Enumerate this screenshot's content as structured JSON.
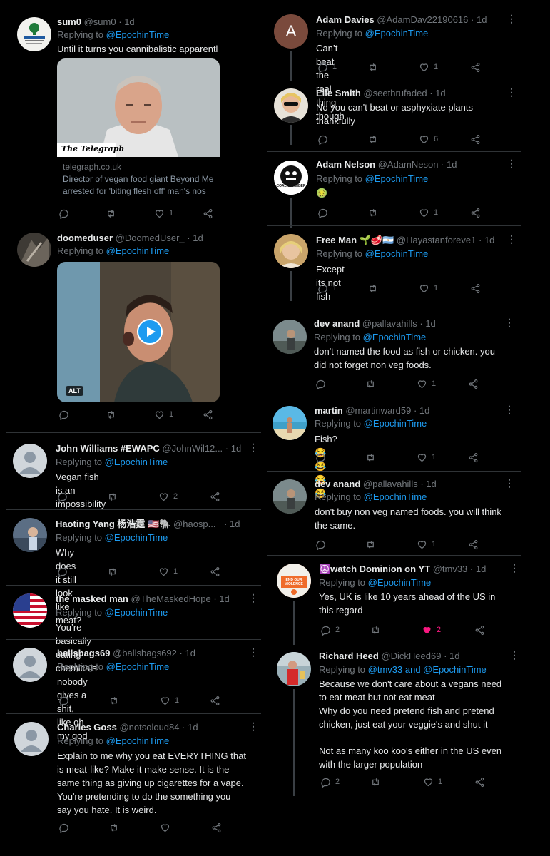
{
  "colors": {
    "bg": "#000000",
    "link": "#1d9bf0",
    "muted": "#71767b",
    "text": "#e7e9ea",
    "like_active": "#f91880"
  },
  "left": [
    {
      "name": "sum0",
      "handle": "@sum0",
      "time": "1d",
      "reply_label": "Replying to",
      "reply_to": "@EpochinTime",
      "text": "Until it turns you cannibalistic apparentl",
      "card": {
        "brand": "The Telegraph",
        "domain": "telegraph.co.uk",
        "desc1": "Director of vegan food giant Beyond Me",
        "desc2": "arrested for 'biting flesh off' man's nos"
      },
      "likes": "1"
    },
    {
      "name": "doomeduser",
      "handle": "@DoomedUser_",
      "time": "1d",
      "reply_label": "Replying to",
      "reply_to": "@EpochinTime",
      "media_alt": "ALT",
      "likes": "1"
    },
    {
      "name": "John Williams #EWAPC",
      "handle": "@JohnWil12...",
      "time": "1d",
      "reply_label": "Replying to",
      "reply_to": "@EpochinTime",
      "text": "Vegan fish is an impossibility",
      "likes": "2"
    },
    {
      "name": "Haoting Yang 杨浩霆 🇺🇸🐘",
      "handle": "@haosp...",
      "time": "1d",
      "reply_label": "Replying to",
      "reply_to": "@EpochinTime",
      "text": "Why does it still look like meat?",
      "likes": "1"
    },
    {
      "name": "the masked man",
      "handle": "@TheMaskedHope",
      "time": "1d",
      "reply_label": "Replying to",
      "reply_to": "@EpochinTime",
      "text": "You’re basically eating chemicals"
    },
    {
      "name": "ballsbags69",
      "handle": "@ballsbags692",
      "time": "1d",
      "reply_label": "Replying to",
      "reply_to": "@EpochinTime",
      "text": "nobody gives a shit, like oh my god",
      "likes": "1"
    },
    {
      "name": "Charles Goss",
      "handle": "@notsoloud84",
      "time": "1d",
      "reply_label": "Replying to",
      "reply_to": "@EpochinTime",
      "lines": [
        "Explain to me why you eat EVERYTHING that",
        "is meat-like? Make it make sense. It is the",
        "same thing as giving up cigarettes for a vape.",
        "You're pretending to do the something you",
        "say you hate. It is weird."
      ]
    }
  ],
  "right": [
    {
      "name": "Adam Davies",
      "handle": "@AdamDav22190616",
      "time": "1d",
      "avatar_letter": "A",
      "reply_label": "Replying to",
      "reply_to": "@EpochinTime",
      "text": "Can’t beat the real thing though",
      "replies": "1",
      "likes": "1"
    },
    {
      "name": "Elle Smith",
      "handle": "@seethrufaded",
      "time": "1d",
      "lines": [
        "No you can't beat or asphyxiate plants",
        "thankfully"
      ],
      "likes": "6"
    },
    {
      "name": "Adam Nelson",
      "handle": "@AdamNeson",
      "time": "1d",
      "avatar_text": "COAL CHAMBER",
      "reply_label": "Replying to",
      "reply_to": "@EpochinTime",
      "text": "🤢",
      "likes": "1"
    },
    {
      "name": "Free Man 🌱🥩🇦🇷",
      "handle": "@Hayastanforeve1",
      "time": "1d",
      "reply_label": "Replying to",
      "reply_to": "@EpochinTime",
      "text": "Except its not fish",
      "replies": "1",
      "likes": "1"
    },
    {
      "name": "dev anand",
      "handle": "@pallavahills",
      "time": "1d",
      "reply_label": "Replying to",
      "reply_to": "@EpochinTime",
      "lines": [
        "don't named the food as fish or chicken. you",
        "did not forget non veg foods."
      ],
      "likes": "1"
    },
    {
      "name": "martin",
      "handle": "@martinward59",
      "time": "1d",
      "reply_label": "Replying to",
      "reply_to": "@EpochinTime",
      "text": "Fish? 😂😂😂😂",
      "likes": "1"
    },
    {
      "name": "dev anand",
      "handle": "@pallavahills",
      "time": "1d",
      "reply_label": "Replying to",
      "reply_to": "@EpochinTime",
      "lines": [
        "don't buy non veg named foods. you will think",
        "the same."
      ],
      "likes": "1"
    },
    {
      "name": "☮️watch Dominion on YT",
      "handle": "@tmv33",
      "time": "1d",
      "avatar_text": "END OUR VIOLENCE",
      "reply_label": "Replying to",
      "reply_to": "@EpochinTime",
      "lines": [
        "Yes, UK is like 10 years ahead of the US in",
        "this regard"
      ],
      "replies": "2",
      "likes": "2"
    },
    {
      "name": "Richard Heed",
      "handle": "@DickHeed69",
      "time": "1d",
      "reply_label": "Replying to",
      "reply_to": "@tmv33 and @EpochinTime",
      "lines": [
        "Because we don't care about a vegans need",
        "to eat meat but not eat meat",
        "Why do you need pretend fish and pretend",
        "chicken, just eat your veggie's and shut it",
        "",
        "Not as many koo koo's either in the US even",
        "with the larger population"
      ],
      "replies": "2",
      "likes": "1"
    }
  ]
}
